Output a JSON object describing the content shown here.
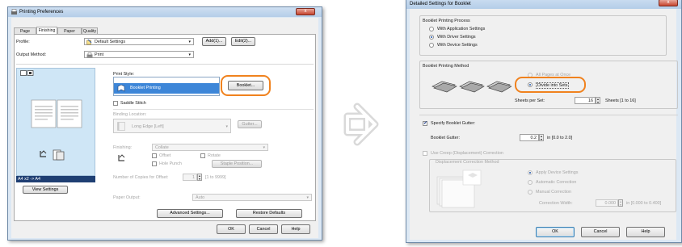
{
  "left_window": {
    "title": "Printing Preferences",
    "close_glyph": "x",
    "tabs": [
      "Page Setup",
      "Finishing",
      "Paper Source",
      "Quality"
    ],
    "active_tab": "Finishing",
    "profile_label": "Profile:",
    "profile_value": "Default Settings",
    "add_button": "Add(1)...",
    "edit_button": "Edit(2)...",
    "output_method_label": "Output Method:",
    "output_method_value": "Print",
    "preview_size": "A4 x2 -> A4",
    "view_settings_button": "View Settings",
    "print_style_label": "Print Style:",
    "print_style_value": "Booklet Printing",
    "booklet_button": "Booklet...",
    "saddle_stitch_label": "Saddle Stitch",
    "binding_location_label": "Binding Location:",
    "binding_location_value": "Long Edge [Left]",
    "gutter_button": "Gutter...",
    "finishing_label": "Finishing:",
    "finishing_value": "Collate",
    "offset_label": "Offset",
    "rotate_label": "Rotate",
    "hole_punch_label": "Hole Punch",
    "staple_position_button": "Staple Position...",
    "copies_offset_label": "Number of Copies for Offset:",
    "copies_offset_value": "1",
    "copies_offset_range": "[1 to 9999]",
    "paper_output_label": "Paper Output:",
    "paper_output_value": "Auto",
    "advanced_settings_button": "Advanced Settings...",
    "restore_defaults_button": "Restore Defaults",
    "ok_button": "OK",
    "cancel_button": "Cancel",
    "help_button": "Help"
  },
  "right_window": {
    "title": "Detailed Settings for Booklet",
    "close_glyph": "x",
    "process_title": "Booklet Printing Process",
    "process_options": [
      "With Application Settings",
      "With Driver Settings",
      "With Device Settings"
    ],
    "process_selected": "With Driver Settings",
    "method_title": "Booklet Printing Method",
    "method_options": [
      "All Pages at Once",
      "Divide into Sets"
    ],
    "method_selected": "Divide into Sets",
    "sheets_per_set_label": "Sheets per Set:",
    "sheets_per_set_value": "16",
    "sheets_per_set_range": "Sheets [1 to 16]",
    "specify_gutter_label": "Specify Booklet Gutter:",
    "specify_gutter_checked": true,
    "gutter_label": "Booklet Gutter:",
    "gutter_value": "0.2",
    "gutter_range": "in [0.0 to 2.0]",
    "creep_label": "Use Creep (Displacement) Correction",
    "displacement_title": "Displacement Correction Method",
    "displacement_options": [
      "Apply Device Settings",
      "Automatic Correction",
      "Manual Correction"
    ],
    "correction_width_label": "Correction Width:",
    "correction_width_value": "0.000",
    "correction_width_range": "in [0.000 to 0.400]",
    "ok_button": "OK",
    "cancel_button": "Cancel",
    "help_button": "Help"
  },
  "colors": {
    "highlight": "#3d86d8",
    "callout_ring": "#f0821e",
    "arrow_gray": "#dcdcdc"
  },
  "icons": [
    "printer-icon",
    "profile-icon",
    "output-print-icon",
    "layout-preview-icon",
    "booklet-stack-icon",
    "booklet-fan-icon",
    "next-arrow-icon"
  ]
}
